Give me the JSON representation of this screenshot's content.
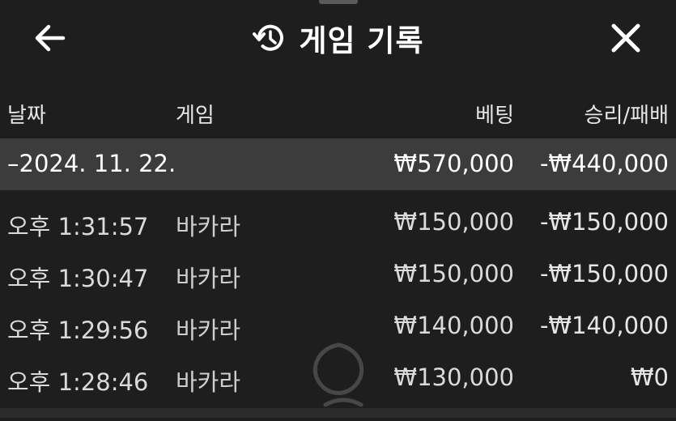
{
  "header": {
    "title": "게임 기록",
    "back_icon": "arrow-left-icon",
    "history_icon": "history-icon",
    "close_icon": "close-icon"
  },
  "columns": {
    "date": "날짜",
    "game": "게임",
    "bet": "베팅",
    "win_loss": "승리/패배"
  },
  "group": {
    "date": "–2024. 11. 22.",
    "bet_total": "₩570,000",
    "win_loss_total": "-₩440,000"
  },
  "rows": [
    {
      "time": "오후 1:31:57",
      "game": "바카라",
      "bet": "₩150,000",
      "win_loss": "-₩150,000"
    },
    {
      "time": "오후 1:30:47",
      "game": "바카라",
      "bet": "₩150,000",
      "win_loss": "-₩150,000"
    },
    {
      "time": "오후 1:29:56",
      "game": "바카라",
      "bet": "₩140,000",
      "win_loss": "-₩140,000"
    },
    {
      "time": "오후 1:28:46",
      "game": "바카라",
      "bet": "₩130,000",
      "win_loss": "₩0"
    }
  ],
  "colors": {
    "background": "#1e1e1e",
    "group_row": "#3c3c3c",
    "text": "#ffffff"
  }
}
